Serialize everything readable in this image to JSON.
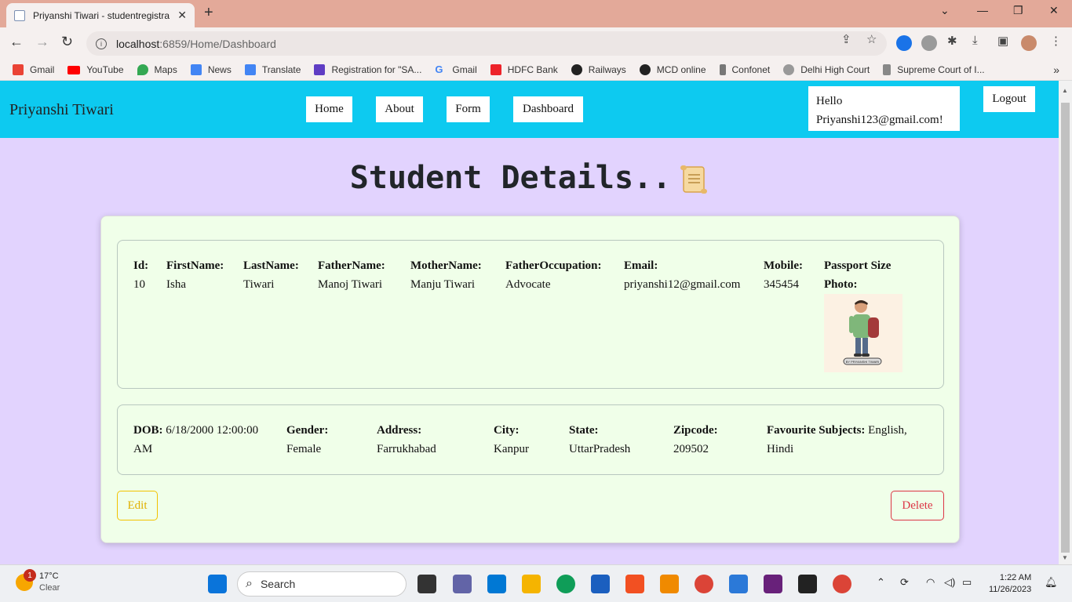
{
  "browser": {
    "tab_title": "Priyanshi Tiwari - studentregistra",
    "url_host": "localhost",
    "url_path": ":6859/Home/Dashboard",
    "bookmarks": [
      "Gmail",
      "YouTube",
      "Maps",
      "News",
      "Translate",
      "Registration for \"SA...",
      "Gmail",
      "HDFC Bank",
      "Railways",
      "MCD online",
      "Confonet",
      "Delhi High Court",
      "Supreme Court of I..."
    ]
  },
  "navbar": {
    "brand": "Priyanshi Tiwari",
    "links": [
      "Home",
      "About",
      "Form",
      "Dashboard"
    ],
    "hello_line1": "Hello",
    "hello_line2": "Priyanshi123@gmail.com!",
    "logout": "Logout"
  },
  "page": {
    "title": "Student Details.."
  },
  "student": {
    "labels": {
      "id": "Id:",
      "first_name": "FirstName:",
      "last_name": "LastName:",
      "father_name": "FatherName:",
      "mother_name": "MotherName:",
      "father_occupation": "FatherOccupation:",
      "email": "Email:",
      "mobile": "Mobile:",
      "photo": "Passport Size Photo:",
      "dob": "DOB:",
      "gender": "Gender:",
      "address": "Address:",
      "city": "City:",
      "state": "State:",
      "zipcode": "Zipcode:",
      "subjects": "Favourite Subjects:"
    },
    "values": {
      "id": "10",
      "first_name": "Isha",
      "last_name": "Tiwari",
      "father_name": "Manoj Tiwari",
      "mother_name": "Manju Tiwari",
      "father_occupation": "Advocate",
      "email": "priyanshi12@gmail.com",
      "mobile": "345454",
      "photo_caption": "BY PRIYANSHI TIWARI",
      "dob": "6/18/2000 12:00:00 AM",
      "gender": "Female",
      "address": "Farrukhabad",
      "city": "Kanpur",
      "state": "UttarPradesh",
      "zipcode": "209502",
      "subjects": "English, Hindi"
    }
  },
  "actions": {
    "edit": "Edit",
    "delete": "Delete"
  },
  "taskbar": {
    "weather_temp": "17°C",
    "weather_desc": "Clear",
    "weather_badge": "1",
    "search_placeholder": "Search",
    "time": "1:22 AM",
    "date": "11/26/2023"
  }
}
